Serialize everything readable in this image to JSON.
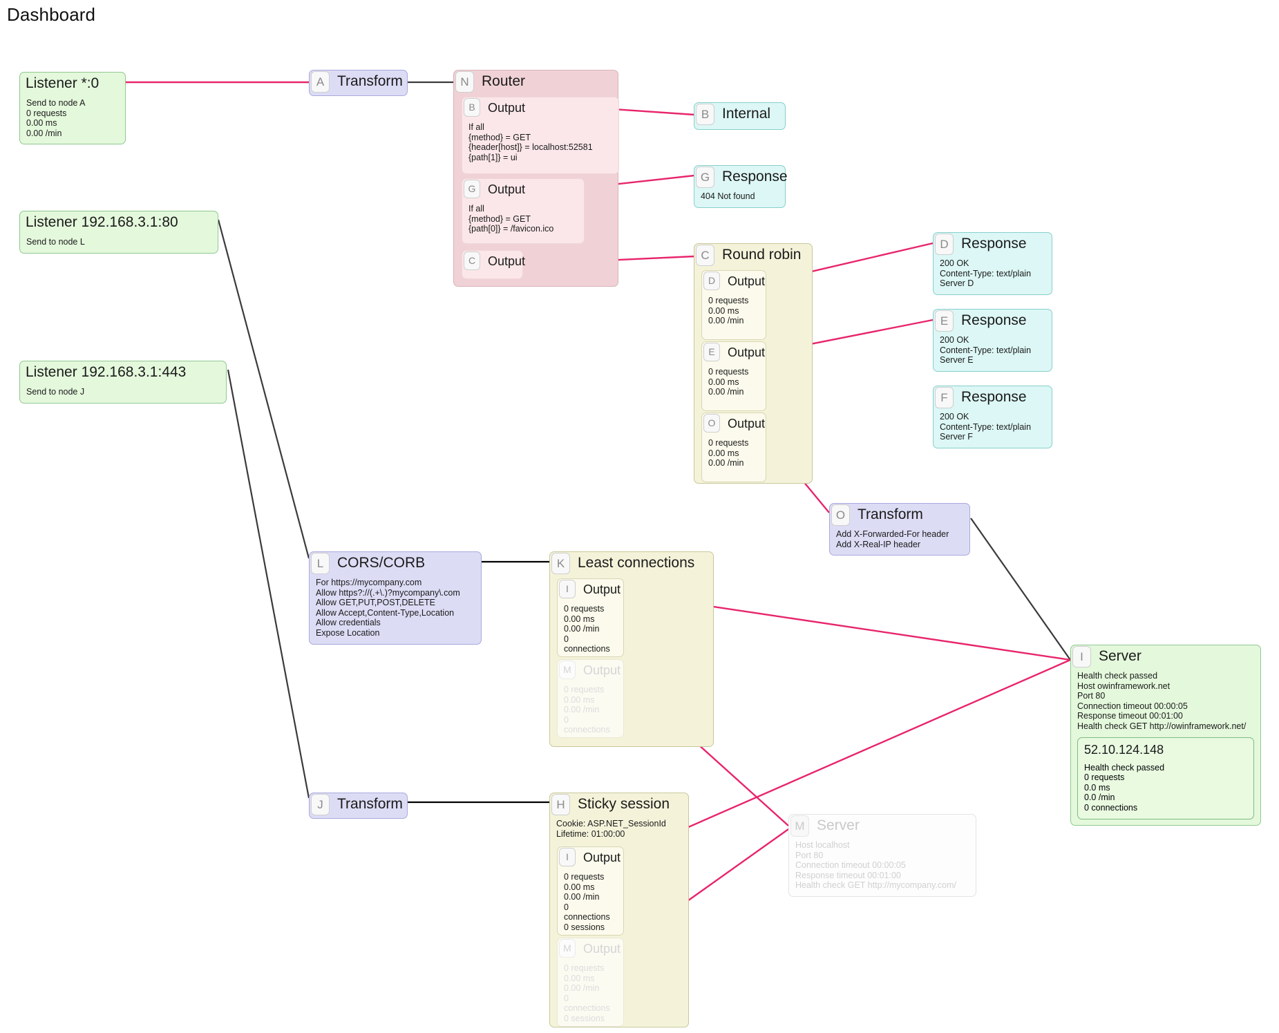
{
  "page": {
    "title": "Dashboard"
  },
  "colors": {
    "edge_pink": "#e8246c",
    "edge_black": "#3a3a3a",
    "green": "#e4f8dc",
    "purple": "#dcdcf5",
    "pink": "#f0d2d6",
    "cyan": "#dcf7f5",
    "yellow": "#f4f3da"
  },
  "nodes": {
    "listener_a": {
      "title": "Listener *:0",
      "body": "Send to node A\n0 requests\n0.00 ms\n0.00 /min"
    },
    "listener_l": {
      "title": "Listener 192.168.3.1:80",
      "body": "Send to node L"
    },
    "listener_j": {
      "title": "Listener 192.168.3.1:443",
      "body": "Send to node J"
    },
    "transform_a": {
      "badge": "A",
      "title": "Transform"
    },
    "router_n": {
      "badge": "N",
      "title": "Router",
      "outputs": [
        {
          "badge": "B",
          "title": "Output",
          "body": "If all\n{method} = GET\n{header[host]} = localhost:52581\n{path[1]} = ui"
        },
        {
          "badge": "G",
          "title": "Output",
          "body": "If all\n{method} = GET\n{path[0]} = /favicon.ico"
        },
        {
          "badge": "C",
          "title": "Output",
          "body": ""
        }
      ]
    },
    "internal_b": {
      "badge": "B",
      "title": "Internal"
    },
    "response_g": {
      "badge": "G",
      "title": "Response",
      "body": "404 Not found"
    },
    "roundrobin_c": {
      "badge": "C",
      "title": "Round robin",
      "outputs": [
        {
          "badge": "D",
          "title": "Output",
          "body": "0 requests\n0.00 ms\n0.00 /min"
        },
        {
          "badge": "E",
          "title": "Output",
          "body": "0 requests\n0.00 ms\n0.00 /min"
        },
        {
          "badge": "O",
          "title": "Output",
          "body": "0 requests\n0.00 ms\n0.00 /min"
        }
      ]
    },
    "response_d": {
      "badge": "D",
      "title": "Response",
      "body": "200 OK\nContent-Type: text/plain\nServer D"
    },
    "response_e": {
      "badge": "E",
      "title": "Response",
      "body": "200 OK\nContent-Type: text/plain\nServer E"
    },
    "response_f": {
      "badge": "F",
      "title": "Response",
      "body": "200 OK\nContent-Type: text/plain\nServer F"
    },
    "transform_o": {
      "badge": "O",
      "title": "Transform",
      "body": "Add X-Forwarded-For header\nAdd X-Real-IP header"
    },
    "cors_l": {
      "badge": "L",
      "title": "CORS/CORB",
      "body": "For https://mycompany.com\nAllow https?://(.+\\.)?mycompany\\.com\nAllow GET,PUT,POST,DELETE\nAllow Accept,Content-Type,Location\nAllow credentials\nExpose Location"
    },
    "least_connections_k": {
      "badge": "K",
      "title": "Least connections",
      "outputs": [
        {
          "badge": "I",
          "title": "Output",
          "body": "0 requests\n0.00 ms\n0.00 /min\n0 connections",
          "dim": false
        },
        {
          "badge": "M",
          "title": "Output",
          "body": "0 requests\n0.00 ms\n0.00 /min\n0 connections",
          "dim": true
        }
      ]
    },
    "transform_j": {
      "badge": "J",
      "title": "Transform"
    },
    "sticky_session_h": {
      "badge": "H",
      "title": "Sticky session",
      "body": "Cookie: ASP.NET_SessionId\nLifetime: 01:00:00",
      "outputs": [
        {
          "badge": "I",
          "title": "Output",
          "body": "0 requests\n0.00 ms\n0.00 /min\n0 connections\n0 sessions",
          "dim": false
        },
        {
          "badge": "M",
          "title": "Output",
          "body": "0 requests\n0.00 ms\n0.00 /min\n0 connections\n0 sessions",
          "dim": true
        }
      ]
    },
    "server_i": {
      "badge": "I",
      "title": "Server",
      "body": "Health check passed\nHost owinframework.net\nPort 80\nConnection timeout 00:00:05\nResponse timeout 00:01:00\nHealth check GET http://owinframework.net/",
      "ip": {
        "address": "52.10.124.148",
        "body": "Health check passed\n0 requests\n0.0 ms\n0.0 /min\n0 connections"
      }
    },
    "server_m": {
      "badge": "M",
      "title": "Server",
      "body": "Host localhost\nPort 80\nConnection timeout 00:00:05\nResponse timeout 00:01:00\nHealth check GET http://mycompany.com/"
    }
  }
}
